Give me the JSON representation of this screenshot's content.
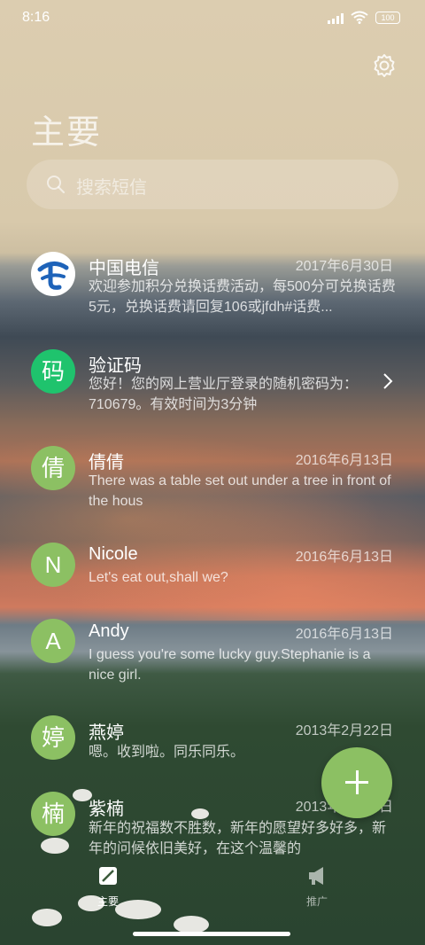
{
  "status_bar": {
    "time": "8:16",
    "battery": "100"
  },
  "header": {
    "title": "主要"
  },
  "search": {
    "placeholder": "搜索短信"
  },
  "conversations": [
    {
      "avatar_text": "",
      "avatar_color": "#ffffff",
      "name": "中国电信",
      "date": "2017年6月30日",
      "preview": "欢迎参加积分兑换话费活动，每500分可兑换话费5元，兑换话费请回复106或jfdh#话费..."
    },
    {
      "avatar_text": "码",
      "avatar_color": "#1fc36d",
      "name": "验证码",
      "date": "",
      "preview": "您好！您的网上营业厅登录的随机密码为：710679。有效时间为3分钟"
    },
    {
      "avatar_text": "倩",
      "avatar_color": "#8cc063",
      "name": "倩倩",
      "date": "2016年6月13日",
      "preview": "There was a table set out under a tree in front of the hous"
    },
    {
      "avatar_text": "N",
      "avatar_color": "#8cc063",
      "name": "Nicole",
      "date": "2016年6月13日",
      "preview": "Let's eat out,shall we?"
    },
    {
      "avatar_text": "A",
      "avatar_color": "#8cc063",
      "name": "Andy",
      "date": "2016年6月13日",
      "preview": "I guess you're some lucky guy.Stephanie is a nice girl."
    },
    {
      "avatar_text": "婷",
      "avatar_color": "#8cc063",
      "name": "燕婷",
      "date": "2013年2月22日",
      "preview": "嗯。收到啦。同乐同乐。"
    },
    {
      "avatar_text": "楠",
      "avatar_color": "#8cc063",
      "name": "紫楠",
      "date": "2013年2月22日",
      "preview": "新年的祝福数不胜数，新年的愿望好多好多，新年的问候依旧美好，在这个温馨的"
    }
  ],
  "tabs": [
    {
      "label": "主要",
      "icon": "compose-icon"
    },
    {
      "label": "推广",
      "icon": "megaphone-icon"
    }
  ],
  "colors": {
    "accent": "#8cc063",
    "verify_green": "#1fc36d",
    "telecom_blue": "#1e63b9"
  }
}
